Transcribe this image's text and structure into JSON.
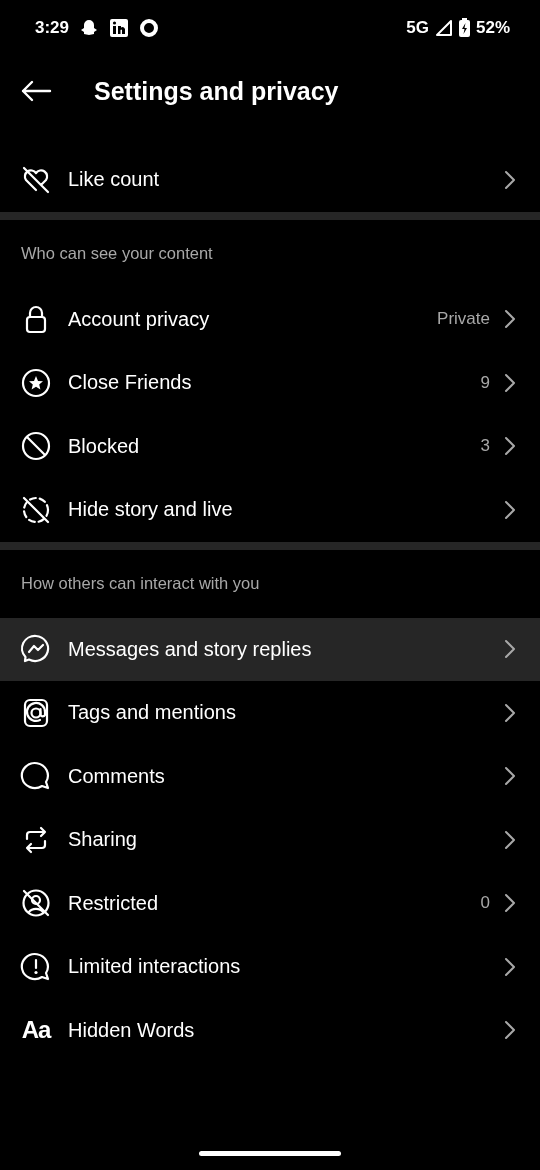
{
  "status_bar": {
    "time": "3:29",
    "network": "5G",
    "battery": "52%"
  },
  "header": {
    "title": "Settings and privacy"
  },
  "sections": [
    {
      "items": [
        {
          "label": "Like count",
          "selected": false
        }
      ]
    },
    {
      "title": "Who can see your content",
      "items": [
        {
          "label": "Account privacy",
          "value": "Private",
          "selected": false
        },
        {
          "label": "Close Friends",
          "value": "9",
          "selected": false
        },
        {
          "label": "Blocked",
          "value": "3",
          "selected": false
        },
        {
          "label": "Hide story and live",
          "selected": false
        }
      ]
    },
    {
      "title": "How others can interact with you",
      "items": [
        {
          "label": "Messages and story replies",
          "selected": true
        },
        {
          "label": "Tags and mentions",
          "selected": false
        },
        {
          "label": "Comments",
          "selected": false
        },
        {
          "label": "Sharing",
          "selected": false
        },
        {
          "label": "Restricted",
          "value": "0",
          "selected": false
        },
        {
          "label": "Limited interactions",
          "selected": false
        },
        {
          "label": "Hidden Words",
          "icon_text": "Aa",
          "selected": false
        }
      ]
    }
  ]
}
